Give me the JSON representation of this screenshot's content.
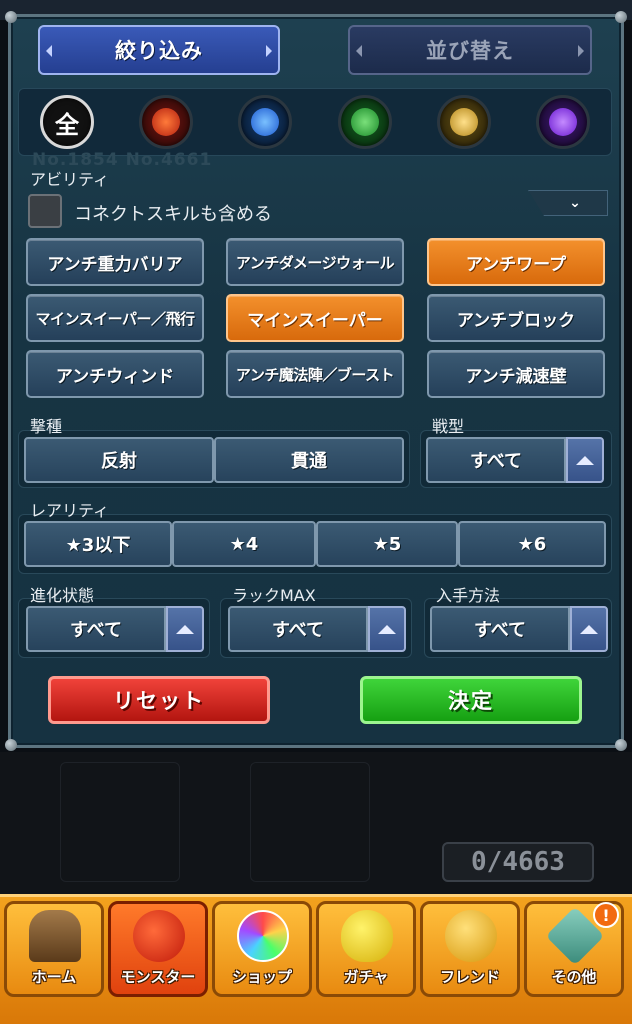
{
  "header": {
    "tab_filter": "絞り込み",
    "tab_sort": "並び替え"
  },
  "elements": {
    "all_label": "全",
    "items": [
      {
        "name": "all",
        "color": "#ffffff"
      },
      {
        "name": "fire",
        "color": "#d23a2a"
      },
      {
        "name": "water",
        "color": "#2e7ae0"
      },
      {
        "name": "wood",
        "color": "#2aa83a"
      },
      {
        "name": "light",
        "color": "#d6a73a"
      },
      {
        "name": "dark",
        "color": "#8a3ad6"
      }
    ]
  },
  "background_text": "No.1854 No.4661",
  "ability": {
    "title": "アビリティ",
    "connect_skill_label": "コネクトスキルも含める",
    "connect_skill_checked": false,
    "buttons": [
      {
        "label": "アンチ重力バリア",
        "selected": false
      },
      {
        "label": "アンチダメージウォール",
        "selected": false
      },
      {
        "label": "アンチワープ",
        "selected": true
      },
      {
        "label": "マインスイーパー／飛行",
        "selected": false
      },
      {
        "label": "マインスイーパー",
        "selected": true
      },
      {
        "label": "アンチブロック",
        "selected": false
      },
      {
        "label": "アンチウィンド",
        "selected": false
      },
      {
        "label": "アンチ魔法陣／ブースト",
        "selected": false
      },
      {
        "label": "アンチ減速壁",
        "selected": false
      }
    ]
  },
  "strike_type": {
    "title": "撃種",
    "options": [
      "反射",
      "貫通"
    ]
  },
  "battle_type": {
    "title": "戦型",
    "value": "すべて"
  },
  "rarity": {
    "title": "レアリティ",
    "options": [
      "★3以下",
      "★4",
      "★5",
      "★6"
    ]
  },
  "evolution": {
    "title": "進化状態",
    "value": "すべて"
  },
  "luck_max": {
    "title": "ラックMAX",
    "value": "すべて"
  },
  "obtain_method": {
    "title": "入手方法",
    "value": "すべて"
  },
  "actions": {
    "reset": "リセット",
    "confirm": "決定"
  },
  "counter": "0/4663",
  "nav": {
    "items": [
      {
        "label": "ホーム",
        "icon": "home-icon",
        "active": false
      },
      {
        "label": "モンスター",
        "icon": "monster-icon",
        "active": true
      },
      {
        "label": "ショップ",
        "icon": "shop-orb-icon",
        "active": false
      },
      {
        "label": "ガチャ",
        "icon": "gacha-egg-icon",
        "active": false
      },
      {
        "label": "フレンド",
        "icon": "friend-icon",
        "active": false
      },
      {
        "label": "その他",
        "icon": "other-icon",
        "active": false
      }
    ],
    "badge": "!"
  }
}
